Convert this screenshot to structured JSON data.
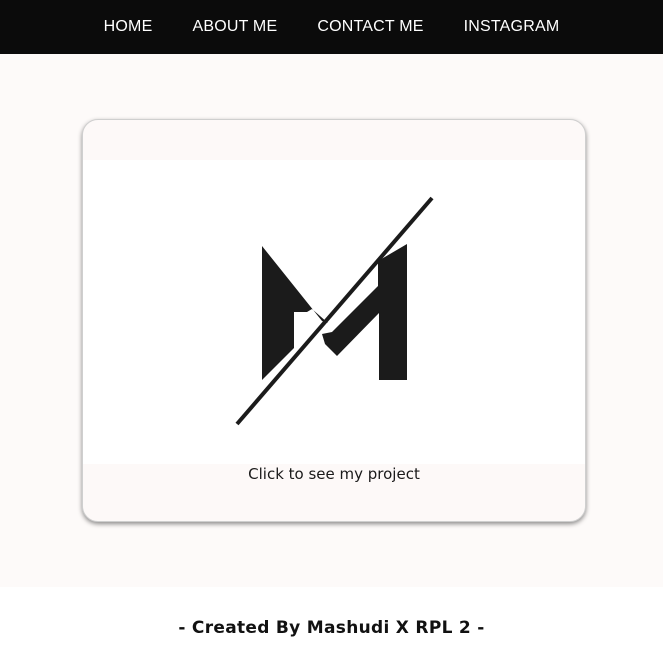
{
  "nav": {
    "items": [
      {
        "label": "HOME"
      },
      {
        "label": "ABOUT ME"
      },
      {
        "label": "CONTACT ME"
      },
      {
        "label": "INSTAGRAM"
      }
    ]
  },
  "card": {
    "logo_icon": "m-monogram-logo",
    "caption": "Click to see my project"
  },
  "footer": {
    "text": "- Created By Mashudi X RPL 2 -"
  },
  "colors": {
    "navbar_bg": "#0b0b0b",
    "nav_text": "#ffffff",
    "page_bg": "#fdfaf9",
    "logo": "#1b1b1b"
  }
}
